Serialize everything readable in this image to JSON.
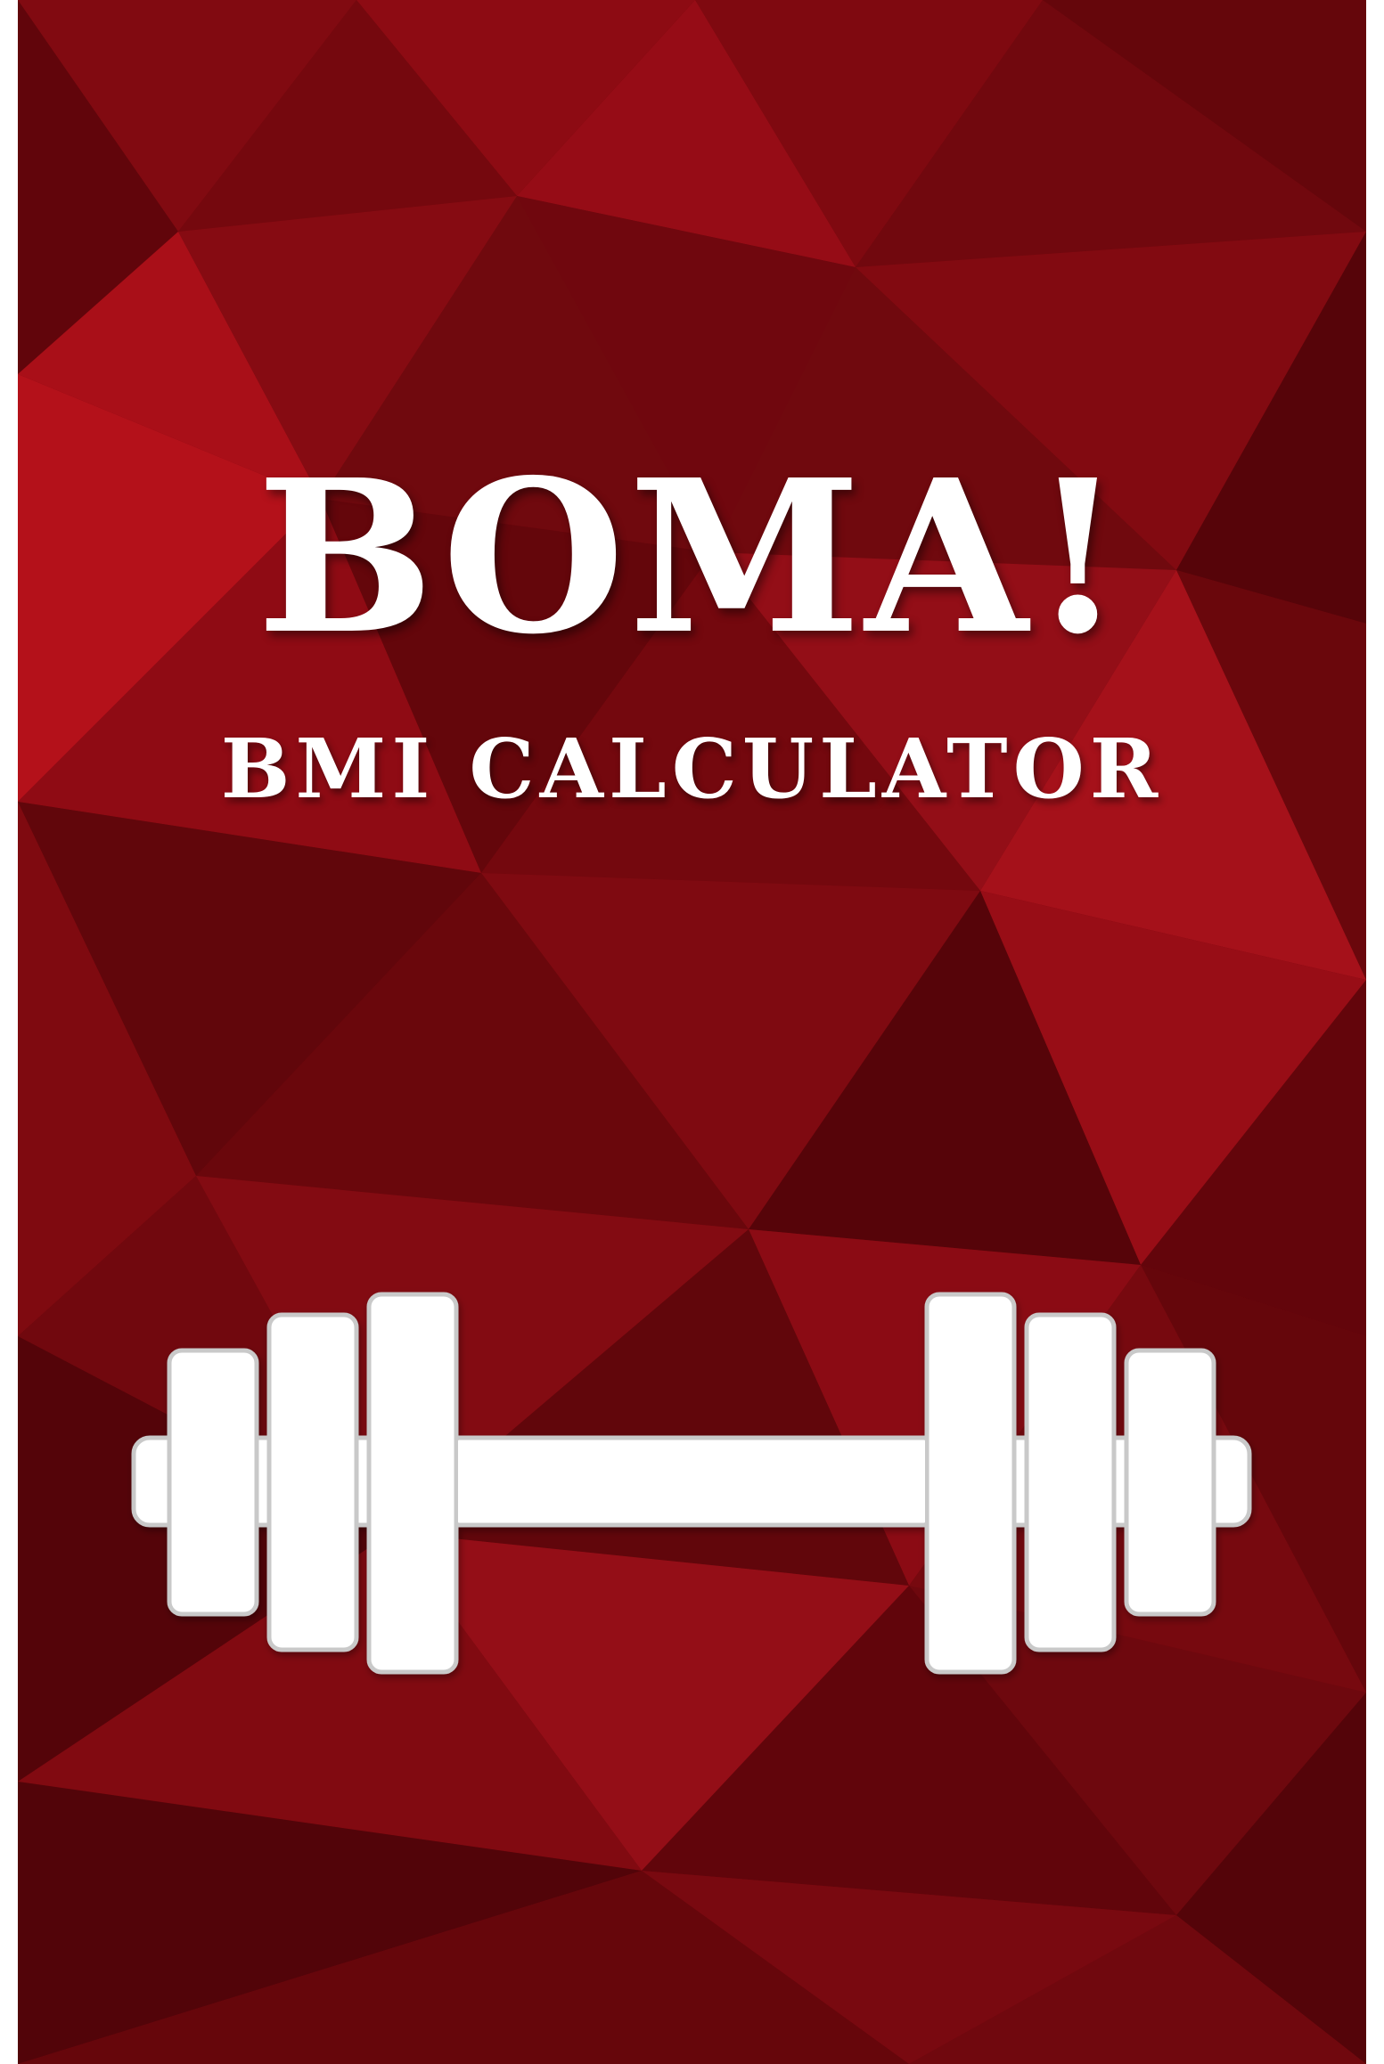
{
  "splash": {
    "title": "BOMA!",
    "subtitle": "BMI CALCULATOR",
    "icon": "dumbbell-icon"
  },
  "colors": {
    "background_dark": "#5a0409",
    "background_mid": "#8e0a12",
    "background_light": "#c8121c",
    "text": "#ffffff",
    "icon_fill": "#ffffff",
    "icon_outline": "#c9c9c9"
  }
}
